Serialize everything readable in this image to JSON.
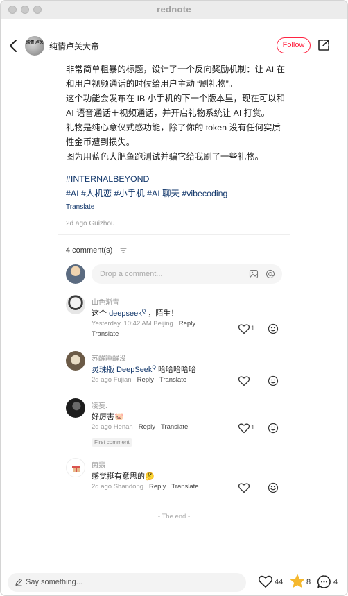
{
  "window": {
    "title": "rednote"
  },
  "header": {
    "author_name": "纯情卢关大帝",
    "avatar_text": "纯情 卢关",
    "follow_label": "Follow"
  },
  "post": {
    "lines": [
      "非常简单粗暴的标题，设计了一个反向奖励机制：让 AI 在",
      "和用户视频通话的时候给用户主动 “刷礼物”。",
      "这个功能会发布在 IB 小手机的下一个版本里，现在可以和",
      " AI 语音通话＋视频通话，并开启礼物系统让 AI 打赏。",
      "礼物是纯心意仪式感功能，除了你的 token 没有任何实质",
      "性金币遭到损失。",
      "图为用蓝色大肥鱼跑测试并骗它给我刷了一些礼物。"
    ],
    "tag_line1": "#INTERNALBEYOND",
    "tag_line2": "#AI #人机恋 #小手机 #AI 聊天 #vibecoding",
    "translate": "Translate",
    "meta": "2d ago Guizhou"
  },
  "comments_section": {
    "count_label": "4 comment(s)",
    "input_placeholder": "Drop a comment..."
  },
  "comments": [
    {
      "name": "山色渐青",
      "text_prefix": "这个 ",
      "mention": "deepseek",
      "mention_sup": "Q",
      "text_suffix": " ，陌生！",
      "meta": "Yesterday, 10:42 AM Beijing",
      "reply": "Reply",
      "translate": "Translate",
      "likes": "1"
    },
    {
      "name": "苏醒睡醒没",
      "mention": "灵珠版 DeepSeek",
      "mention_sup": "Q",
      "text_suffix": " 哈哈哈哈哈",
      "meta": "2d ago Fujian",
      "reply": "Reply",
      "translate": "Translate"
    },
    {
      "name": "凌妄.",
      "text": "好厉害",
      "emoji": "🐷",
      "meta": "2d ago Henan",
      "reply": "Reply",
      "translate": "Translate",
      "likes": "1",
      "badge": "First comment"
    },
    {
      "name": "茵翡",
      "text": "感觉挺有意思的",
      "emoji": "🤔",
      "meta": "2d ago Shandong",
      "reply": "Reply",
      "translate": "Translate"
    }
  ],
  "end_label": "- The end -",
  "bottom_bar": {
    "say_label": "Say something...",
    "likes": "44",
    "stars": "8",
    "comments": "4"
  },
  "colors": {
    "accent": "#ff2442",
    "link": "#13386c",
    "star": "#f5b82e"
  }
}
